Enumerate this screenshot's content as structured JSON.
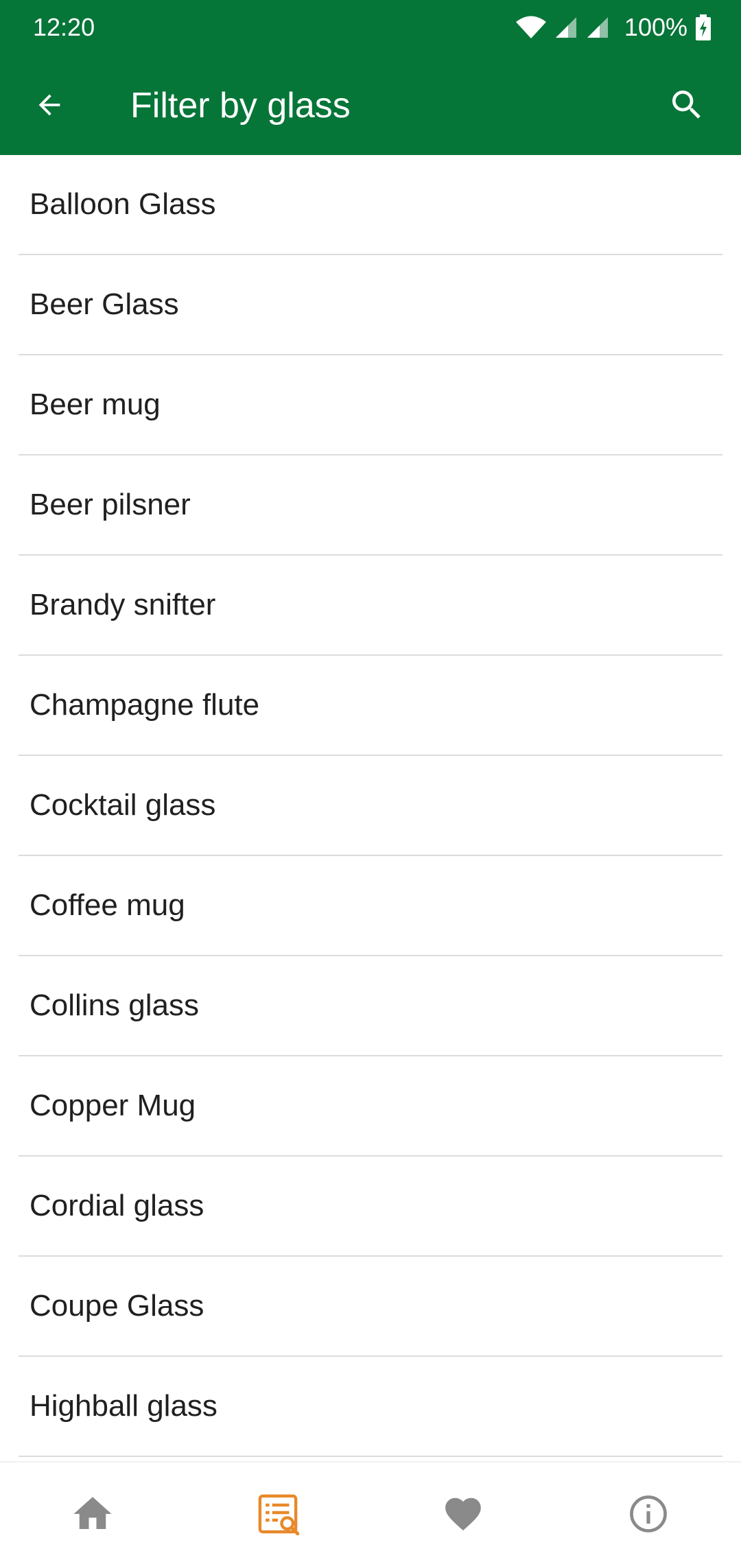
{
  "status_bar": {
    "time": "12:20",
    "battery": "100%"
  },
  "app_bar": {
    "title": "Filter by glass",
    "back_icon": "arrow-back-icon",
    "search_icon": "search-icon"
  },
  "list": {
    "items": [
      "Balloon Glass",
      "Beer Glass",
      "Beer mug",
      "Beer pilsner",
      "Brandy snifter",
      "Champagne flute",
      "Cocktail glass",
      "Coffee mug",
      "Collins glass",
      "Copper Mug",
      "Cordial glass",
      "Coupe Glass",
      "Highball glass"
    ]
  },
  "bottom_nav": {
    "items": [
      {
        "icon": "home-icon",
        "active": false
      },
      {
        "icon": "filter-list-icon",
        "active": true
      },
      {
        "icon": "heart-icon",
        "active": false
      },
      {
        "icon": "info-icon",
        "active": false
      }
    ]
  },
  "colors": {
    "primary": "#067538",
    "accent": "#E8892B",
    "inactive_icon": "#8A8A8A",
    "divider": "#DCDCDC",
    "text": "#202020"
  }
}
